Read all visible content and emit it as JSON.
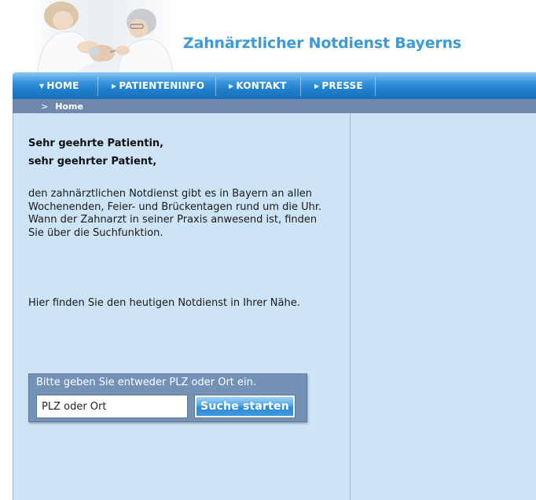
{
  "header": {
    "site_title": "Zahnärztlicher Notdienst Bayerns"
  },
  "nav": {
    "items": [
      {
        "label": "HOME",
        "arrow": "down-arrow"
      },
      {
        "label": "PATIENTENINFO",
        "arrow": "right-arrow"
      },
      {
        "label": "KONTAKT",
        "arrow": "right-arrow"
      },
      {
        "label": "PRESSE",
        "arrow": "right-arrow"
      }
    ]
  },
  "breadcrumb": {
    "separator": ">",
    "current": "Home"
  },
  "content": {
    "greeting_line1": "Sehr geehrte Patientin,",
    "greeting_line2": "sehr geehrter Patient,",
    "intro_line1": "den zahnärztlichen Notdienst gibt es in Bayern an allen",
    "intro_line2": "Wochenenden, Feier- und Brückentagen rund um die Uhr.",
    "intro_line3": "Wann der Zahnarzt in seiner Praxis anwesend ist, finden",
    "intro_line4": "Sie über die Suchfunktion.",
    "find_text": "Hier finden Sie den heutigen Notdienst in Ihrer Nähe."
  },
  "search": {
    "label": "Bitte geben Sie entweder PLZ oder Ort ein.",
    "input_value": "PLZ oder Ort",
    "button_label": "Suche starten"
  },
  "colors": {
    "title_blue": "#3c9ad7",
    "nav_blue": "#1f7fcc",
    "breadcrumb_bg": "#6f88ad",
    "content_bg": "#cde3f6",
    "search_box_bg": "#7491b6"
  }
}
